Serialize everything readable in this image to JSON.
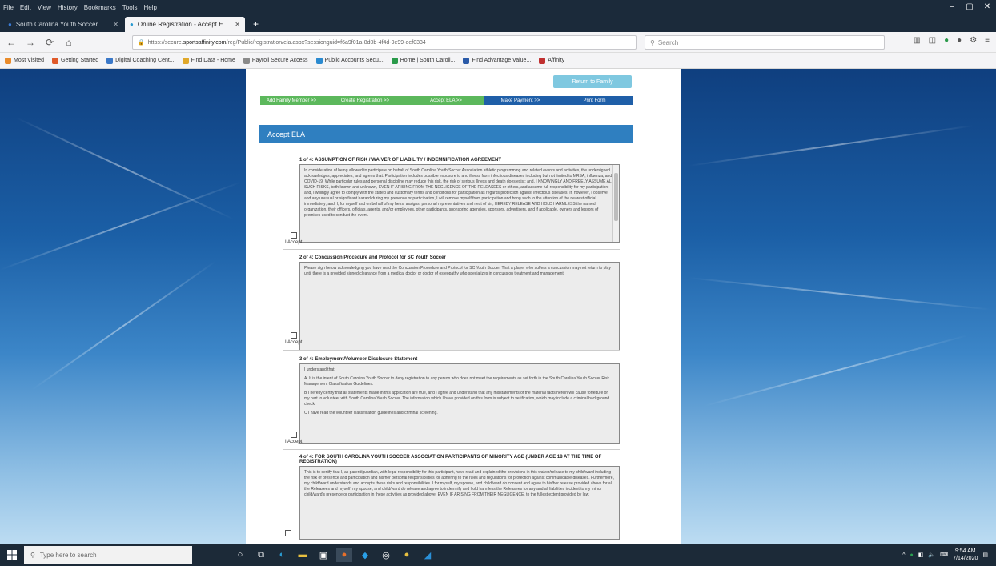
{
  "menu": [
    "File",
    "Edit",
    "View",
    "History",
    "Bookmarks",
    "Tools",
    "Help"
  ],
  "window_controls": [
    "–",
    "▢",
    "✕"
  ],
  "tabs": [
    {
      "label": "South Carolina Youth Soccer",
      "close": "✕",
      "active": false
    },
    {
      "label": "Online Registration - Accept E",
      "close": "✕",
      "active": true
    }
  ],
  "new_tab": "+",
  "nav": {
    "back": "←",
    "forward": "→",
    "reload": "⟳",
    "home": "⌂"
  },
  "url": {
    "prefix": "https://secure.",
    "domain": "sportsaffinity.com",
    "rest": "/reg/Public/registration/ela.aspx?sessionguid=f6a9f01a-8d0b-4f4d-9e99-eef0334"
  },
  "search_placeholder": "Search",
  "bookmarks": [
    {
      "label": "Most Visited",
      "color": "#e98b2a"
    },
    {
      "label": "Getting Started",
      "color": "#e05a2a"
    },
    {
      "label": "Digital Coaching Cent...",
      "color": "#3a78c8"
    },
    {
      "label": "Find Data - Home",
      "color": "#e0a82a"
    },
    {
      "label": "Payroll Secure Access",
      "color": "#8a8a8a"
    },
    {
      "label": "Public Accounts Secu...",
      "color": "#2a8ad0"
    },
    {
      "label": "Home | South Caroli...",
      "color": "#2a9a4a"
    },
    {
      "label": "Find Advantage Value...",
      "color": "#2a5aa8"
    },
    {
      "label": "Affinity",
      "color": "#c03030"
    }
  ],
  "page": {
    "register_button": "Return to Family",
    "steps": [
      {
        "label": "Add Family Member >>",
        "color": "#5cb85c"
      },
      {
        "label": "Create Registration >>",
        "color": "#5cb85c"
      },
      {
        "label": "Accept ELA >>",
        "color": "#5cb85c"
      },
      {
        "label": "Make Payment >>",
        "color": "#1f5fa8"
      },
      {
        "label": "Print Form",
        "color": "#1f5fa8"
      }
    ],
    "panel_title": "Accept ELA",
    "accept_label": "I Accept",
    "sections": [
      {
        "title": "1 of 4:  ASSUMPTION OF RISK / WAIVER OF LIABILITY / INDEMNIFICATION AGREEMENT",
        "paras": [
          "In consideration of being allowed to participate on behalf of South Carolina Youth Soccer Association athletic programming and related events and activities, the undersigned acknowledges, appreciates, and agrees that: Participation includes possible exposure to and illness from infectious diseases including but not limited to MRSA, influenza, and COVID-19. While particular rules and personal discipline may reduce this risk, the risk of serious illness and death does exist; and, I KNOWINGLY AND FREELY ASSUME ALL SUCH RISKS, both known and unknown, EVEN IF ARISING FROM THE NEGLIGENCE OF THE RELEASEES or others, and assume full responsibility for my participation; and, I willingly agree to comply with the stated and customary terms and conditions for participation as regards protection against infectious diseases. If, however, I observe and any unusual or significant hazard during my presence or participation, I will remove myself from participation and bring such to the attention of the nearest official immediately; and, I, for myself and on behalf of my heirs, assigns, personal representatives and next of kin, HEREBY RELEASE AND HOLD HARMLESS the named organization, their officers, officials, agents, and/or employees, other participants, sponsoring agencies, sponsors, advertisers, and if applicable, owners and lessors of premises used to conduct the event."
        ],
        "scroll": true
      },
      {
        "title": "2 of 4:  Concussion Procedure and Protocol for SC Youth Soccer",
        "paras": [
          "Please sign below acknowledging you have read the Concussion Procedure and Protocol for SC Youth Soccer. That a player who suffers a concussion may not return to play until there is a provided signed clearance from a medical doctor or doctor of osteopathy who specializes in concussion treatment and management."
        ],
        "scroll": false
      },
      {
        "title": "3 of 4:  Employment/Volunteer Disclosure Statement",
        "paras": [
          "I understand that:",
          "A. It is the intent of South Carolina Youth Soccer to deny registration to any person who does not meet the requirements as set forth in the South Carolina Youth Soccer Risk Management Classification Guidelines.",
          "B I hereby certify that all statements made in this application are true, and I agree and understand that any misstatements of the material facts herein will cause forfeiture on my part to volunteer with South Carolina Youth Soccer. The information which I have provided on this form is subject to verification, which may include a criminal background check.",
          "C I have read the volunteer classification guidelines and criminal screening."
        ],
        "scroll": false
      },
      {
        "title": "4 of 4:  FOR SOUTH CAROLINA YOUTH SOCCER ASSOCIATION PARTICIPANTS OF MINORITY AGE (UNDER AGE 18 AT THE TIME OF REGISTRATION)",
        "paras": [
          "This is to certify that I, as parent/guardian, with legal responsibility for this participant, have read and explained the provisions in this waiver/release to my child/ward including the risk of presence and participation and his/her personal responsibilities for adhering to the rules and regulations for protection against communicable diseases. Furthermore, my child/ward understands and accepts these risks and responsibilities. I for myself, my spouse, and child/ward do consent and agree to his/her release provided above for all the Releasees and myself, my spouse, and child/ward do release and agree to indemnify and hold harmless the Releasees for any and all liabilities incident to my minor child/ward's presence or participation in these activities as provided above, EVEN IF ARISING FROM THEIR NEGLIGENCE, to the fullest extent provided by law."
        ],
        "scroll": false
      }
    ]
  },
  "taskbar": {
    "search_placeholder": "Type here to search",
    "time": "9:54 AM",
    "date": "7/14/2020"
  }
}
